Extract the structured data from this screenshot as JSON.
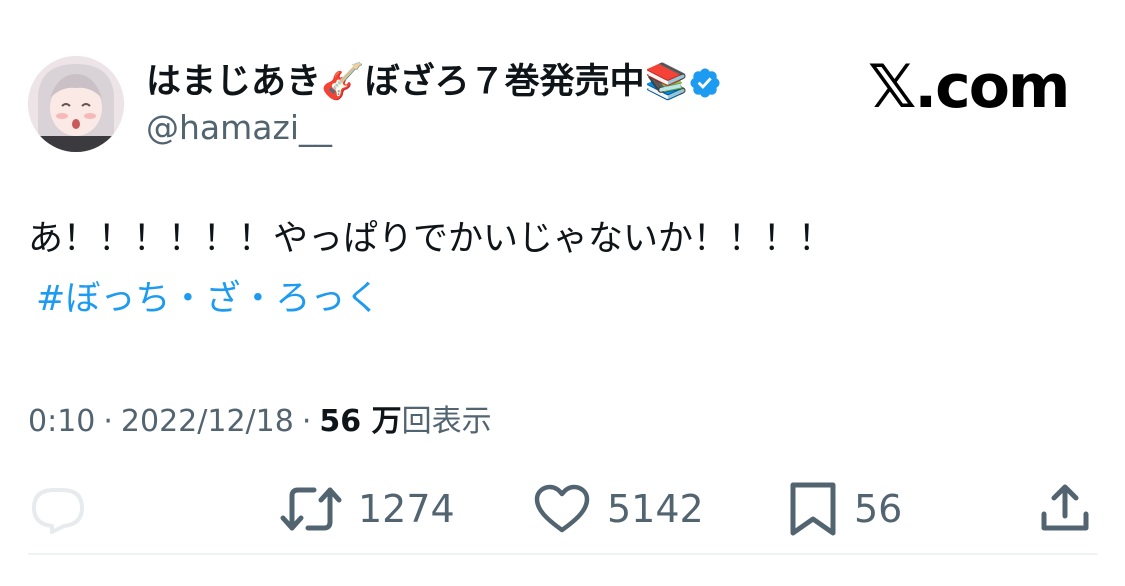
{
  "author": {
    "display_name": "はまじあき🎸ぼざろ７巻発売中📚",
    "handle": "@hamazi__",
    "verified": true
  },
  "site_logo": "𝕏.com",
  "tweet": {
    "text": "あ！！！！！！やっぱりでかいじゃないか！！！！",
    "hashtag": "#ぼっち・ざ・ろっく"
  },
  "meta": {
    "time": "0:10",
    "separator": "·",
    "date": "2022/12/18",
    "views_count": "56 万",
    "views_label": "回表示"
  },
  "actions": {
    "reply": {
      "icon": "reply-icon",
      "count": ""
    },
    "retweet": {
      "icon": "retweet-icon",
      "count": "1274"
    },
    "like": {
      "icon": "heart-icon",
      "count": "5142"
    },
    "bookmark": {
      "icon": "bookmark-icon",
      "count": "56"
    },
    "share": {
      "icon": "share-icon",
      "count": ""
    }
  },
  "colors": {
    "link": "#1d9bf0",
    "secondary_text": "#536471",
    "verified": "#1d9bf0"
  }
}
